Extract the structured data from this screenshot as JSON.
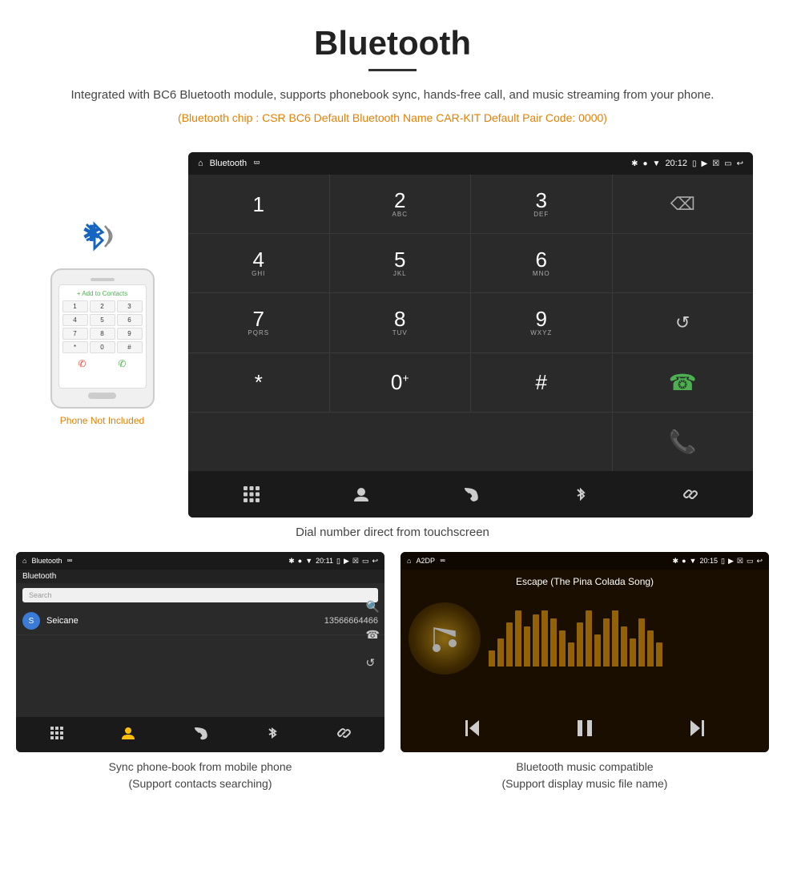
{
  "page": {
    "title": "Bluetooth",
    "underline": true,
    "subtitle": "Integrated with BC6 Bluetooth module, supports phonebook sync, hands-free call, and music streaming from your phone.",
    "info_line": "(Bluetooth chip : CSR BC6    Default Bluetooth Name CAR-KIT    Default Pair Code: 0000)",
    "dial_caption": "Dial number direct from touchscreen",
    "phone_not_included": "Phone Not Included",
    "bottom_left_caption": "Sync phone-book from mobile phone\n(Support contacts searching)",
    "bottom_right_caption": "Bluetooth music compatible\n(Support display music file name)"
  },
  "dial_screen": {
    "status_app": "Bluetooth",
    "status_time": "20:12",
    "keys": [
      {
        "num": "1",
        "sub": ""
      },
      {
        "num": "2",
        "sub": "ABC"
      },
      {
        "num": "3",
        "sub": "DEF"
      },
      {
        "num": "",
        "sub": ""
      },
      {
        "num": "4",
        "sub": "GHI"
      },
      {
        "num": "5",
        "sub": "JKL"
      },
      {
        "num": "6",
        "sub": "MNO"
      },
      {
        "num": "",
        "sub": ""
      },
      {
        "num": "7",
        "sub": "PQRS"
      },
      {
        "num": "8",
        "sub": "TUV"
      },
      {
        "num": "9",
        "sub": "WXYZ"
      },
      {
        "num": "",
        "sub": "redial"
      },
      {
        "num": "*",
        "sub": ""
      },
      {
        "num": "0",
        "sub": "+"
      },
      {
        "num": "#",
        "sub": ""
      },
      {
        "num": "",
        "sub": "call_green"
      },
      {
        "num": "",
        "sub": "end_red"
      }
    ],
    "bottom_icons": [
      "grid",
      "person",
      "phone",
      "bluetooth",
      "link"
    ]
  },
  "phonebook_screen": {
    "status_app": "Bluetooth",
    "status_time": "20:11",
    "search_placeholder": "Search",
    "contact": {
      "initial": "S",
      "name": "Seicane",
      "number": "13566664466"
    },
    "bottom_icons": [
      "grid",
      "person-fill",
      "phone",
      "bluetooth",
      "link"
    ]
  },
  "music_screen": {
    "status_app": "A2DP",
    "status_time": "20:15",
    "song_title": "Escape (The Pina Colada Song)",
    "eq_bars": [
      20,
      35,
      55,
      70,
      50,
      65,
      80,
      60,
      45,
      30,
      55,
      70,
      40,
      60,
      75,
      50,
      35,
      60,
      45,
      30
    ],
    "controls": [
      "prev",
      "play-pause",
      "next"
    ]
  },
  "colors": {
    "orange": "#e67e00",
    "android_bg": "#2a2a2a",
    "status_bg": "#1a1a1a",
    "green_call": "#4caf50",
    "red_end": "#f44336",
    "blue_bt": "#1565c0"
  }
}
